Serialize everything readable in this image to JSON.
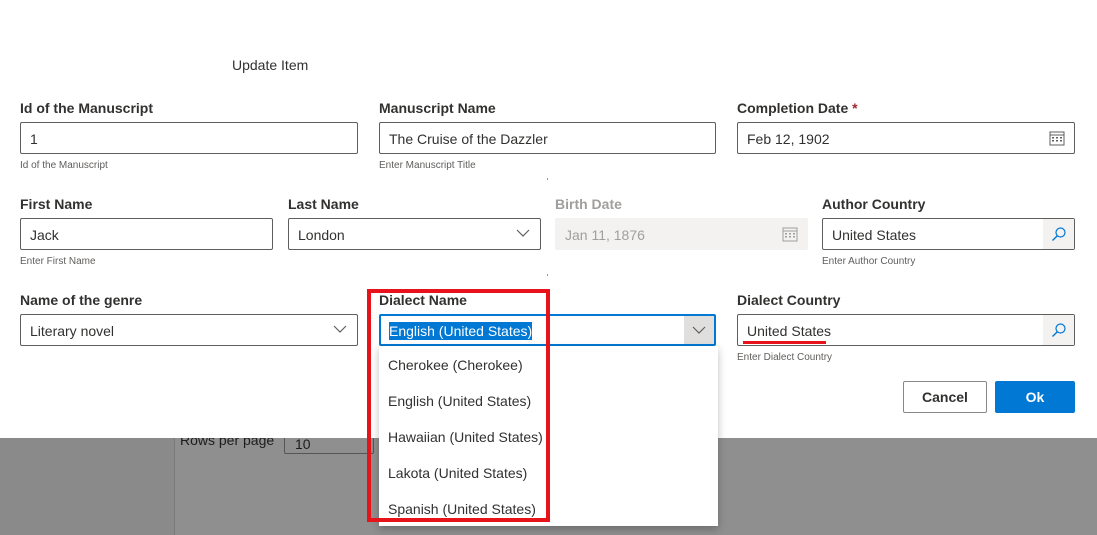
{
  "dialog": {
    "title": "Update Item"
  },
  "fields": {
    "manuscript_id": {
      "label": "Id of the Manuscript",
      "value": "1",
      "hint": "Id of the Manuscript"
    },
    "manuscript_name": {
      "label": "Manuscript Name",
      "value": "The Cruise of the Dazzler",
      "hint": "Enter Manuscript Title"
    },
    "completion_date": {
      "label": "Completion Date",
      "required_mark": "*",
      "value": "Feb 12, 1902"
    },
    "first_name": {
      "label": "First Name",
      "value": "Jack",
      "hint": "Enter First Name"
    },
    "last_name": {
      "label": "Last Name",
      "value": "London"
    },
    "birth_date": {
      "label": "Birth Date",
      "value": "Jan 11, 1876"
    },
    "author_country": {
      "label": "Author Country",
      "value": "United States",
      "hint": "Enter Author Country"
    },
    "genre": {
      "label": "Name of the genre",
      "value": "Literary novel"
    },
    "dialect_name": {
      "label": "Dialect Name",
      "value": "English (United States)"
    },
    "dialect_country": {
      "label": "Dialect Country",
      "value": "United States",
      "hint": "Enter Dialect Country"
    }
  },
  "dialect_options": [
    "Cherokee (Cherokee)",
    "English (United States)",
    "Hawaiian (United States)",
    "Lakota (United States)",
    "Spanish (United States)"
  ],
  "buttons": {
    "cancel": "Cancel",
    "ok": "Ok"
  },
  "background": {
    "rows_per_page_label": "Rows per page",
    "rows_per_page_value": "10"
  },
  "colors": {
    "accent": "#0078d4",
    "highlight": "#e8121b"
  }
}
